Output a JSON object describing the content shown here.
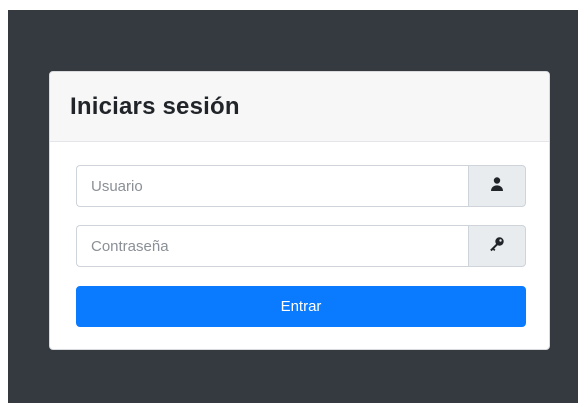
{
  "login": {
    "title": "Iniciars sesión",
    "username_placeholder": "Usuario",
    "password_placeholder": "Contraseña",
    "submit_label": "Entrar"
  },
  "icons": {
    "username": "user-icon",
    "password": "key-icon"
  },
  "colors": {
    "background": "#343a40",
    "primary": "#0a7bff",
    "addon": "#e9ecef"
  }
}
